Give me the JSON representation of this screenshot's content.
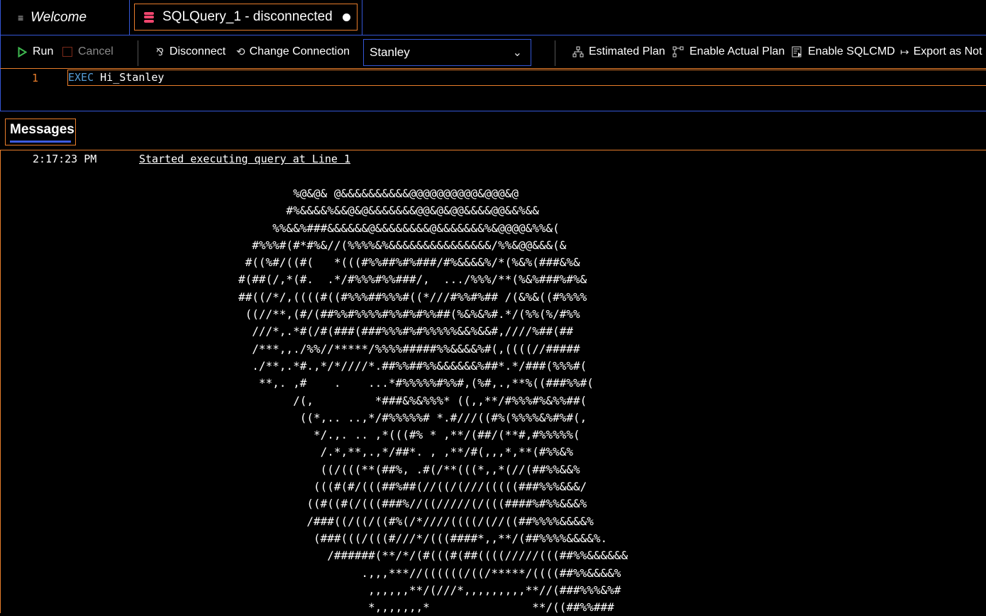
{
  "tabs": [
    {
      "label": "Welcome",
      "icon": "document-lines-icon",
      "active": false
    },
    {
      "label": "SQLQuery_1 - disconnected",
      "icon": "database-icon",
      "active": true,
      "unsaved_indicator": "dot"
    }
  ],
  "toolbar": {
    "run_label": "Run",
    "cancel_label": "Cancel",
    "disconnect_label": "Disconnect",
    "change_connection_label": "Change Connection",
    "database_selected": "Stanley",
    "estimated_plan_label": "Estimated Plan",
    "enable_actual_plan_label": "Enable Actual Plan",
    "enable_sqlcmd_label": "Enable SQLCMD",
    "export_notebook_label": "Export as Not"
  },
  "editor": {
    "lines": [
      {
        "number": "1",
        "keyword": "EXEC",
        "rest": " Hi_Stanley"
      }
    ]
  },
  "results": {
    "tab_label": "Messages",
    "messages": [
      {
        "time": "2:17:23 PM",
        "text": "Started executing query at Line 1"
      }
    ],
    "output_art": [
      "        %@&@& @&&&&&&&&&&@@@@@@@@@@&@@@&@",
      "       #%&&&&%&&@&@&&&&&&&@@&@&@@&&&&@@&&%&&",
      "     %%&&%###&&&&&&@&&&&&&&&@&&&&&&&%&@@@@&%%&(",
      "  #%%%#(#*#%&//(%%%%&%&&&&&&&&&&&&&&&/%%&@@&&&(&",
      " #((%#/((#(   *(((#%%##%#%###/#%&&&&%/*(%&%(###&%&",
      "#(##(/,*(#.  .*/#%%%#%%###/,  .../%%%/**(%&%###%#%&",
      "##((/*/,((((#((#%%%##%%%#((*///#%%#%## /(&%&((#%%%%",
      " ((//**,(#/(##%%#%%%%#%%#%#%%##(%&%&%#.*/(%%(%/#%%",
      "  ///*,.*#(/#(###(###%%%#%#%%%%%&&%&&#,////%##(##",
      "  /***,,./%%//*****/%%%%#####%%&&&&%#(,((((//#####",
      "  ./**,.*#.,*/*////*.##%%##%%&&&&&&%##*.*/###(%%%#(",
      "   **,. ,#    .    ...*#%%%%%#%%#,(%#,.,**%((###%%#(",
      "        /(,         *###&%&%%%* ((,,**/#%%%#%&%%##(",
      "         ((*,.. ..,*/#%%%%%# *.#///((#%(%%%%&%#%#(,",
      "           */.,. .. ,*(((#% * ,**/(##/(**#,#%%%%%(",
      "            /.*,**,.,*/##*. , ,**/#(,,,*,**(#%%&%",
      "            ((/(((**(##%, .#(/**(((*,,*(//(##%%&&%",
      "           (((#(#/(((##%##(//((/(///(((((###%%%&&&/",
      "          ((#((#(/(((###%//((/////(/(((####%#%%&&&%",
      "          /###((/((/((#%(/*////((((/(//((##%%%%&&&&%",
      "           (###(((/(((#///*/(((####*,,**/(##%%%%&&&&%.",
      "             /######(**/*/(#(((#(##((((/////(((##%%&&&&&&",
      "                  .,,,***//((((((/((/*****/((((##%%&&&&%",
      "                   ,,,,,,**/(///*,,,,,,,,,**//(###%%%&%#",
      "                   *,,,,,,,*               **/((##%%###"
    ]
  },
  "colors": {
    "background": "#000000",
    "focus_border": "#e87d2b",
    "panel_border": "#3456d6",
    "run_icon": "#3fb950",
    "cancel_icon": "#7a2a1a",
    "keyword": "#569cd6",
    "line_number": "#e87d2b",
    "db_icon": "#f0466e"
  }
}
